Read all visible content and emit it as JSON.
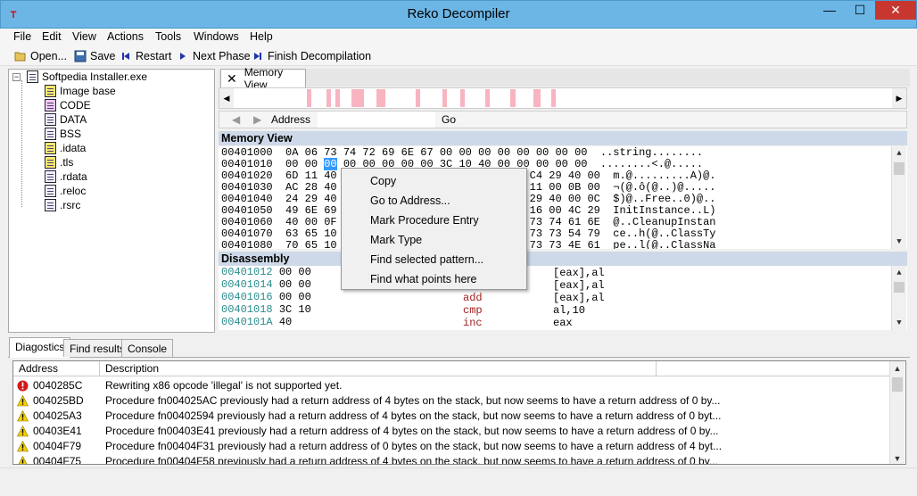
{
  "window": {
    "title": "Reko Decompiler",
    "minimize": "—",
    "maximize": "☐",
    "close": "✕"
  },
  "menu": [
    "File",
    "Edit",
    "View",
    "Actions",
    "Tools",
    "Windows",
    "Help"
  ],
  "toolbar": {
    "open": "Open...",
    "save": "Save",
    "restart": "Restart",
    "next_phase": "Next Phase",
    "finish": "Finish Decompilation"
  },
  "tree": {
    "root": "Softpedia Installer.exe",
    "items": [
      "Image base",
      "CODE",
      "DATA",
      "BSS",
      ".idata",
      ".tls",
      ".rdata",
      ".reloc",
      ".rsrc"
    ]
  },
  "tab": {
    "label": "Memory View"
  },
  "address_bar": {
    "label": "Address",
    "value": "",
    "go": "Go"
  },
  "memory_view": {
    "header": "Memory View",
    "rows": [
      {
        "addr": "00401000",
        "bytes": "0A 06 73 74 72 69 6E 67 00 00 00 00 00 00 00 00",
        "text": "..string........"
      },
      {
        "addr": "00401010",
        "bytes": "00 00 00 00 00 00 00 00 3C 10 40 00 00 00 00 00",
        "text": "........<.@....."
      },
      {
        "addr": "00401020",
        "bytes": "6D 11 40                            0 C4 29 40 00",
        "text": "m.@.........A)@."
      },
      {
        "addr": "00401030",
        "bytes": "AC 28 40                            0 11 00 0B 00",
        "text": "¬(@.ô(@..)@....."
      },
      {
        "addr": "00401040",
        "bytes": "24 29 40                            0 29 40 00 0C",
        "text": "$)@..Free..0)@.."
      },
      {
        "addr": "00401050",
        "bytes": "49 6E 69                            5 16 00 4C 29",
        "text": "InitInstance..L)"
      },
      {
        "addr": "00401060",
        "bytes": "40 00 0F                            E 73 74 61 6E",
        "text": "@..CleanupInstan"
      },
      {
        "addr": "00401070",
        "bytes": "63 65 10                            1 73 73 54 79",
        "text": "ce..h(@..ClassTy"
      },
      {
        "addr": "00401080",
        "bytes": "70 65 10                            1 73 73 4E 61",
        "text": "pe..l(@..ClassNa"
      }
    ],
    "selected_byte": "00"
  },
  "disassembly": {
    "header": "Disassembly",
    "rows": [
      {
        "addr": "00401012",
        "bytes": "00 00",
        "mnemonic": "",
        "operands": "[eax],al"
      },
      {
        "addr": "00401014",
        "bytes": "00 00",
        "mnemonic": "",
        "operands": "[eax],al"
      },
      {
        "addr": "00401016",
        "bytes": "00 00",
        "mnemonic": "add",
        "operands": "[eax],al"
      },
      {
        "addr": "00401018",
        "bytes": "3C 10",
        "mnemonic": "cmp",
        "operands": "al,10"
      },
      {
        "addr": "0040101A",
        "bytes": "40",
        "mnemonic": "inc",
        "operands": "eax"
      }
    ]
  },
  "context_menu": [
    "Copy",
    "Go to Address...",
    "Mark Procedure Entry",
    "Mark Type",
    "Find selected pattern...",
    "Find what points here"
  ],
  "bottom_tabs": [
    "Diagostics",
    "Find results",
    "Console"
  ],
  "diagnostics": {
    "columns": [
      "Address",
      "Description"
    ],
    "rows": [
      {
        "severity": "error",
        "addr": "0040285C",
        "desc": "Rewriting x86 opcode 'illegal' is not supported yet."
      },
      {
        "severity": "warning",
        "addr": "004025BD",
        "desc": "Procedure fn004025AC previously had a return address of 4 bytes on the stack, but now seems to have a return address of 0 by..."
      },
      {
        "severity": "warning",
        "addr": "004025A3",
        "desc": "Procedure fn00402594 previously had a return address of 4 bytes on the stack, but now seems to have a return address of 0 byt..."
      },
      {
        "severity": "warning",
        "addr": "00403E41",
        "desc": "Procedure fn00403E41 previously had a return address of 4 bytes on the stack, but now seems to have a return address of 0 by..."
      },
      {
        "severity": "warning",
        "addr": "00404F79",
        "desc": "Procedure fn00404F31 previously had a return address of 0 bytes on the stack, but now seems to have a return address of 4 byt..."
      },
      {
        "severity": "warning",
        "addr": "00404F75",
        "desc": "Procedure fn00404F58 previously had a return address of 4 bytes on the stack, but now seems to have a return address of 0 by..."
      }
    ]
  },
  "colors": {
    "titlebar": "#6cb6e6",
    "close": "#c7372f",
    "section": "#cdd9e8",
    "addr_teal": "#2a8c8c",
    "mnemonic_red": "#a02020",
    "band_mark": "#f8b4c0"
  }
}
